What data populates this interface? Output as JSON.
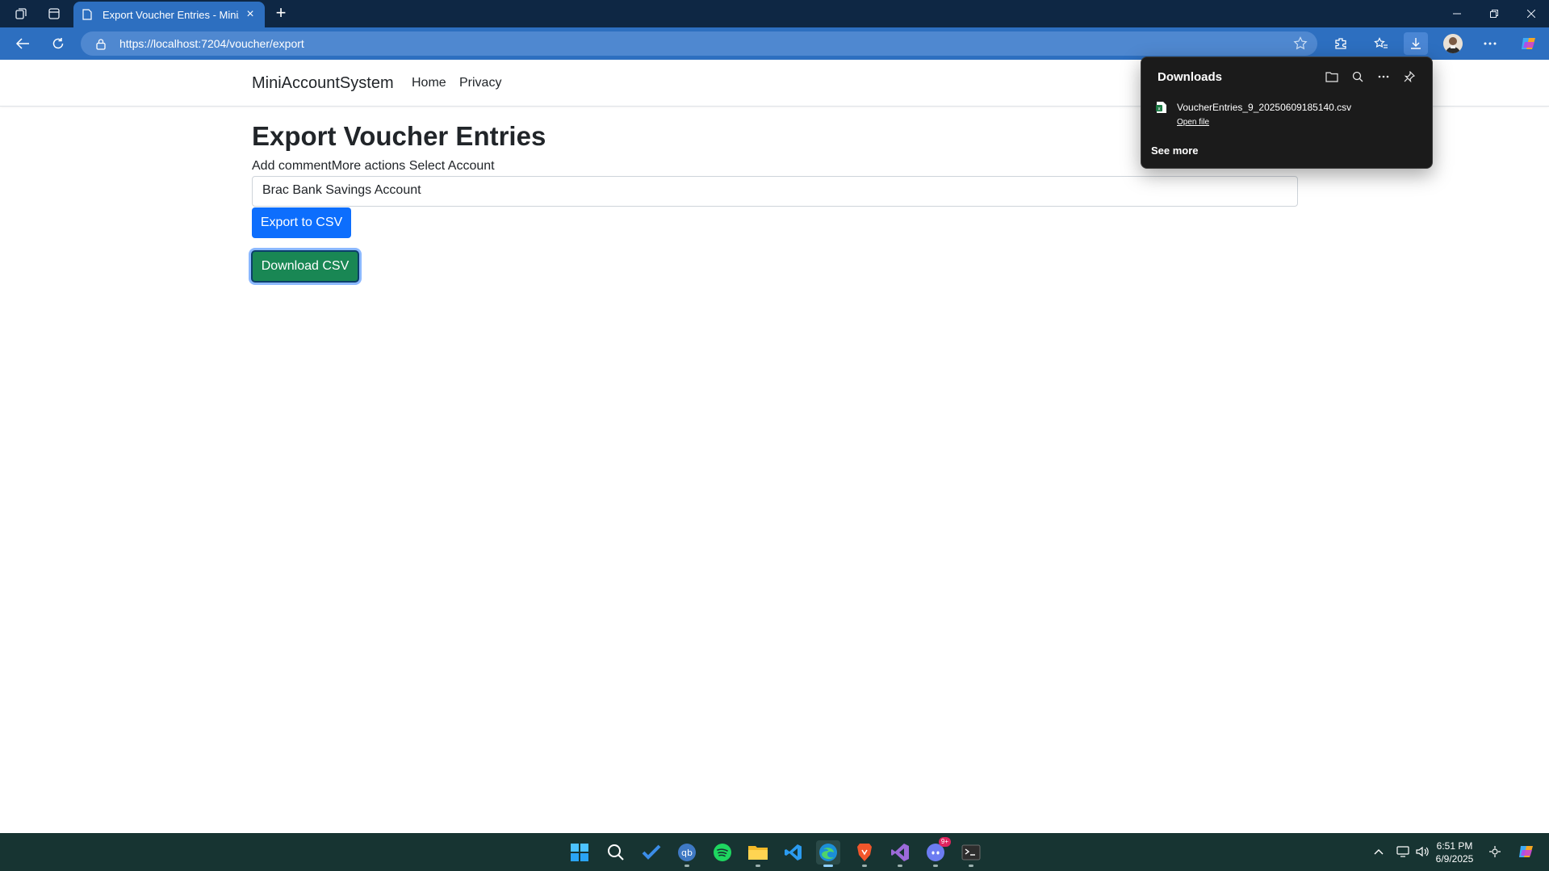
{
  "browser": {
    "tab_title": "Export Voucher Entries - MiniAcc",
    "url": "https://localhost:7204/voucher/export"
  },
  "navbar": {
    "brand": "MiniAccountSystem",
    "links": [
      "Home",
      "Privacy"
    ]
  },
  "main": {
    "heading": "Export Voucher Entries",
    "label": "Add commentMore actions Select Account",
    "account_select_value": "Brac Bank Savings Account",
    "export_button": "Export to CSV",
    "download_button": "Download CSV"
  },
  "downloads": {
    "title": "Downloads",
    "file_name": "VoucherEntries_9_20250609185140.csv",
    "open_file": "Open file",
    "see_more": "See more"
  },
  "taskbar": {
    "time": "6:51 PM",
    "date": "6/9/2025",
    "discord_badge": "9+"
  },
  "colors": {
    "titlebar": "#0e2744",
    "toolbar": "#2d6fc0",
    "primary_button": "#0d6efd",
    "success_button": "#198754",
    "taskbar": "#173432"
  }
}
